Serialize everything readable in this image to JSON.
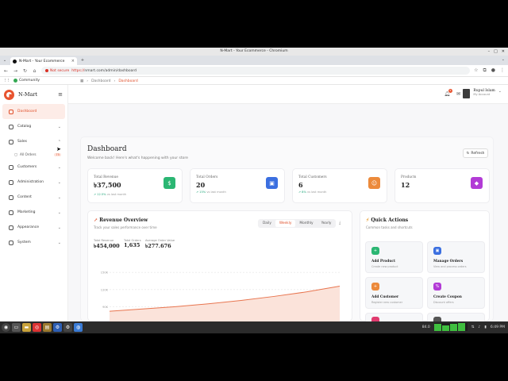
{
  "browser": {
    "window_title": "N-Mart - Your Ecommerce - Chromium",
    "tab_title": "N-Mart - Your Ecommerce",
    "not_secure": "Not secure",
    "url_prefix": "https://",
    "url_rest": "nmart.com/admin/dashboard",
    "bookmark": "Community"
  },
  "app": {
    "brand": "N-Mart",
    "sidebar": [
      {
        "label": "Dashboard",
        "active": true
      },
      {
        "label": "Catalog"
      },
      {
        "label": "Sales"
      },
      {
        "label": "Customers"
      },
      {
        "label": "Administration"
      },
      {
        "label": "Content"
      },
      {
        "label": "Marketing"
      },
      {
        "label": "Appearance"
      },
      {
        "label": "System"
      }
    ],
    "sales_sub": {
      "label": "All Orders",
      "badge": "75"
    },
    "notif_count": "5",
    "user": {
      "name": "Rupul Islam",
      "role": "My Account"
    }
  },
  "breadcrumb": {
    "home": "Dashboard",
    "current": "Dashboard"
  },
  "header": {
    "title": "Dashboard",
    "subtitle": "Welcome back! Here's what's happening with your store",
    "refresh": "Refresh"
  },
  "stats": [
    {
      "label": "Total Revenue",
      "value": "৳37,500",
      "change": "12.5%",
      "suffix": "vs last month",
      "color": "#2bb673",
      "icon": "$"
    },
    {
      "label": "Total Orders",
      "value": "20",
      "change": "15%",
      "suffix": "vs last month",
      "color": "#3b6fe0",
      "icon": "▣"
    },
    {
      "label": "Total Customers",
      "value": "6",
      "change": "8%",
      "suffix": "vs last month",
      "color": "#ec8a3b",
      "icon": "☺"
    },
    {
      "label": "Products",
      "value": "12",
      "change": "",
      "suffix": "",
      "color": "#b23bd6",
      "icon": "◆"
    }
  ],
  "revenue": {
    "title": "Revenue Overview",
    "subtitle": "Track your sales performance over time",
    "tabs": [
      "Daily",
      "Weekly",
      "Monthly",
      "Yearly"
    ],
    "active_tab": "Weekly",
    "metrics": [
      {
        "label": "Total Revenue",
        "value": "৳454,000"
      },
      {
        "label": "Total Orders",
        "value": "1,635"
      },
      {
        "label": "Average Order Value",
        "value": "৳277.676"
      }
    ]
  },
  "chart_data": {
    "type": "area",
    "y_tick_labels": [
      "150K",
      "120K",
      "90K"
    ],
    "series": [
      {
        "values": [
          82,
          86,
          90,
          95,
          101,
          108,
          116,
          126
        ]
      }
    ],
    "ylim": [
      60,
      160
    ],
    "grid": true
  },
  "quick_actions": {
    "title": "Quick Actions",
    "subtitle": "Common tasks and shortcuts",
    "items": [
      {
        "title": "Add Product",
        "sub": "Create new product",
        "color": "#2bb673",
        "icon": "+"
      },
      {
        "title": "Manage Orders",
        "sub": "View and process orders",
        "color": "#3b6fe0",
        "icon": "▣"
      },
      {
        "title": "Add Customer",
        "sub": "Register new customer",
        "color": "#ec8a3b",
        "icon": "+"
      },
      {
        "title": "Create Coupon",
        "sub": "Discount offers",
        "color": "#b23bd6",
        "icon": "%"
      }
    ]
  },
  "taskbar": {
    "time": "6:49 PM",
    "workspace": "84.0"
  }
}
